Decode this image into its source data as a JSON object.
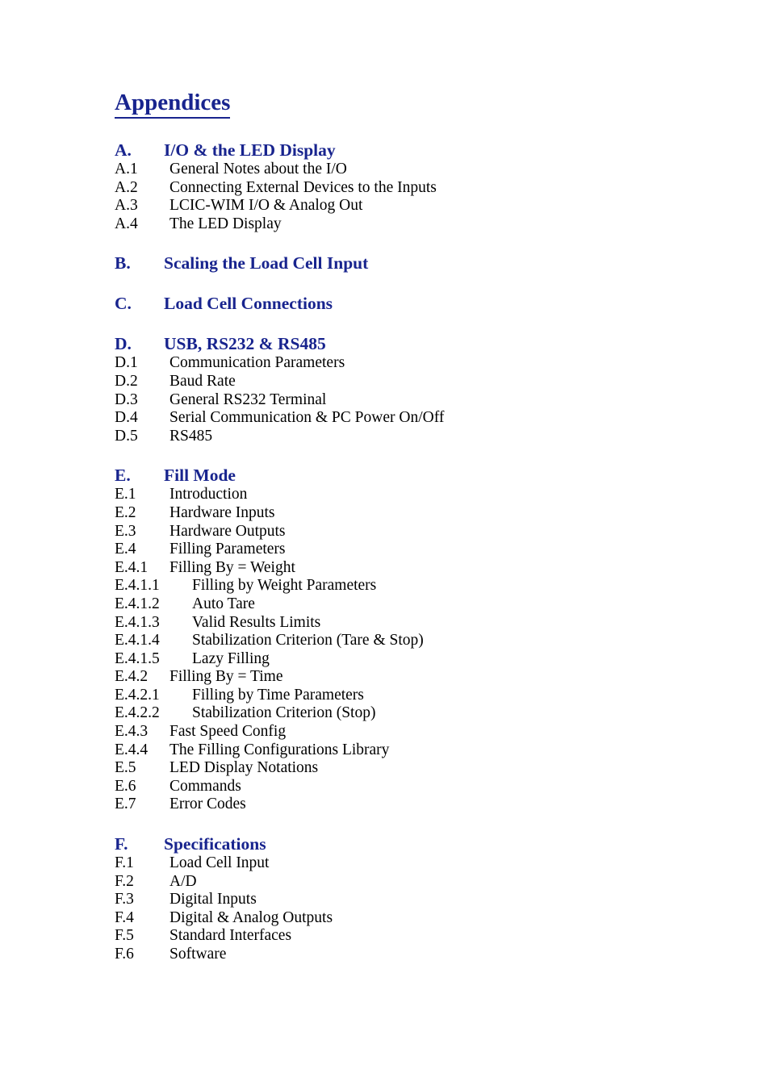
{
  "document": {
    "title": "Appendices",
    "accent_color": "#18248e",
    "text_color": "#000000",
    "background_color": "#ffffff"
  },
  "sections": [
    {
      "label": "A.",
      "title": "I/O & the LED Display",
      "entries": [
        {
          "label": "A.1",
          "text": "General Notes about the I/O",
          "tab": 1
        },
        {
          "label": "A.2",
          "text": "Connecting External Devices to the Inputs",
          "tab": 1
        },
        {
          "label": "A.3",
          "text": "LCIC-WIM I/O & Analog Out",
          "tab": 1
        },
        {
          "label": "A.4",
          "text": "The LED Display",
          "tab": 1
        }
      ]
    },
    {
      "label": "B.",
      "title": "Scaling the Load Cell Input",
      "entries": []
    },
    {
      "label": "C.",
      "title": "Load Cell Connections",
      "entries": []
    },
    {
      "label": "D.",
      "title": "USB, RS232 & RS485",
      "entries": [
        {
          "label": "D.1",
          "text": "Communication Parameters",
          "tab": 1
        },
        {
          "label": "D.2",
          "text": "Baud Rate",
          "tab": 1
        },
        {
          "label": "D.3",
          "text": "General RS232 Terminal",
          "tab": 1
        },
        {
          "label": "D.4",
          "text": "Serial Communication & PC Power On/Off",
          "tab": 1
        },
        {
          "label": "D.5",
          "text": "RS485",
          "tab": 1
        }
      ]
    },
    {
      "label": "E.",
      "title": "Fill Mode",
      "entries": [
        {
          "label": "E.1",
          "text": "Introduction",
          "tab": 1
        },
        {
          "label": "E.2",
          "text": "Hardware Inputs",
          "tab": 1
        },
        {
          "label": "E.3",
          "text": "Hardware Outputs",
          "tab": 1
        },
        {
          "label": "E.4",
          "text": "Filling Parameters",
          "tab": 1
        },
        {
          "label": "E.4.1",
          "text": "Filling By = Weight",
          "tab": 1
        },
        {
          "label": "E.4.1.1",
          "text": "Filling by Weight Parameters",
          "tab": 2
        },
        {
          "label": "E.4.1.2",
          "text": "Auto Tare",
          "tab": 2
        },
        {
          "label": "E.4.1.3",
          "text": "Valid Results Limits",
          "tab": 2
        },
        {
          "label": "E.4.1.4",
          "text": "Stabilization Criterion (Tare & Stop)",
          "tab": 2
        },
        {
          "label": "E.4.1.5",
          "text": "Lazy Filling",
          "tab": 2
        },
        {
          "label": "E.4.2",
          "text": "Filling By = Time",
          "tab": 1
        },
        {
          "label": "E.4.2.1",
          "text": "Filling by Time Parameters",
          "tab": 2
        },
        {
          "label": "E.4.2.2",
          "text": "Stabilization Criterion (Stop)",
          "tab": 2
        },
        {
          "label": "E.4.3",
          "text": "Fast Speed Config",
          "tab": 1
        },
        {
          "label": "E.4.4",
          "text": "The Filling Configurations Library",
          "tab": 1
        },
        {
          "label": "E.5",
          "text": "LED Display Notations",
          "tab": 1
        },
        {
          "label": "E.6",
          "text": "Commands",
          "tab": 1
        },
        {
          "label": "E.7",
          "text": "Error Codes",
          "tab": 1
        }
      ]
    },
    {
      "label": "F.",
      "title": "Specifications",
      "entries": [
        {
          "label": "F.1",
          "text": "Load Cell Input",
          "tab": 1
        },
        {
          "label": "F.2",
          "text": "A/D",
          "tab": 1
        },
        {
          "label": "F.3",
          "text": "Digital Inputs",
          "tab": 1
        },
        {
          "label": "F.4",
          "text": "Digital & Analog Outputs",
          "tab": 1
        },
        {
          "label": "F.5",
          "text": "Standard Interfaces",
          "tab": 1
        },
        {
          "label": "F.6",
          "text": "Software",
          "tab": 1
        }
      ]
    }
  ]
}
